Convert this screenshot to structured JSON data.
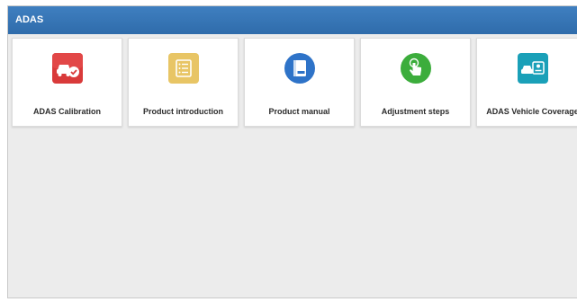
{
  "window": {
    "title": "ADAS"
  },
  "tiles": [
    {
      "label": "ADAS Calibration",
      "icon": "car-check-icon",
      "color": "#d93a3a"
    },
    {
      "label": "Product introduction",
      "icon": "list-icon",
      "color": "#e8c565"
    },
    {
      "label": "Product manual",
      "icon": "book-icon",
      "color": "#2e73c8"
    },
    {
      "label": "Adjustment steps",
      "icon": "hand-tap-icon",
      "color": "#3cad3c"
    },
    {
      "label": "ADAS Vehicle Coverage",
      "icon": "car-card-icon",
      "color": "#1aa0b8"
    }
  ],
  "colors": {
    "titlebar": "#3a78b8",
    "background": "#ececec"
  }
}
